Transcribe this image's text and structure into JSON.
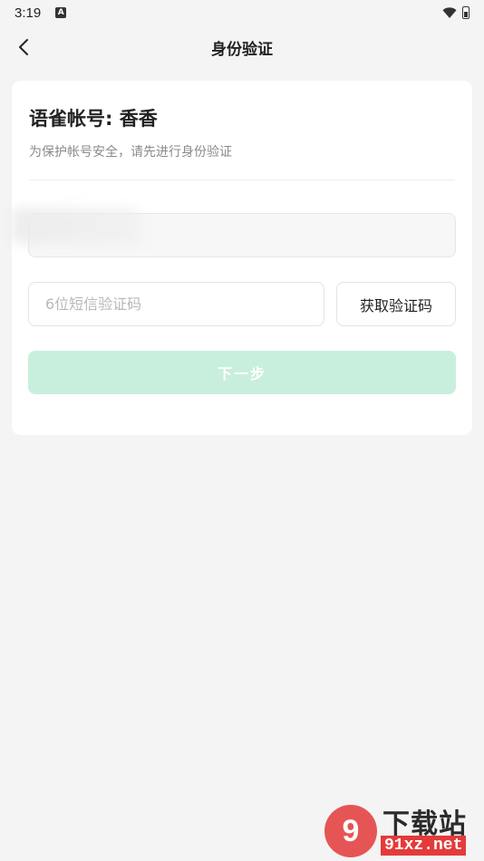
{
  "status_bar": {
    "time": "3:19",
    "app_icon_letter": "A",
    "icons": [
      "wifi-icon",
      "battery-icon"
    ]
  },
  "header": {
    "title": "身份验证",
    "back_icon": "chevron-left-icon"
  },
  "card": {
    "account_line": "语雀帐号: 香香",
    "subtitle": "为保护帐号安全，请先进行身份验证",
    "code_placeholder": "6位短信验证码",
    "get_code_label": "获取验证码",
    "next_label": "下一步"
  },
  "watermark": {
    "logo_text": "9",
    "title": "下载站",
    "domain": "91xz.net"
  },
  "colors": {
    "background": "#f3f4f3",
    "card": "#ffffff",
    "next_button_disabled": "#c8efdd",
    "watermark_red": "#e43a3a"
  }
}
